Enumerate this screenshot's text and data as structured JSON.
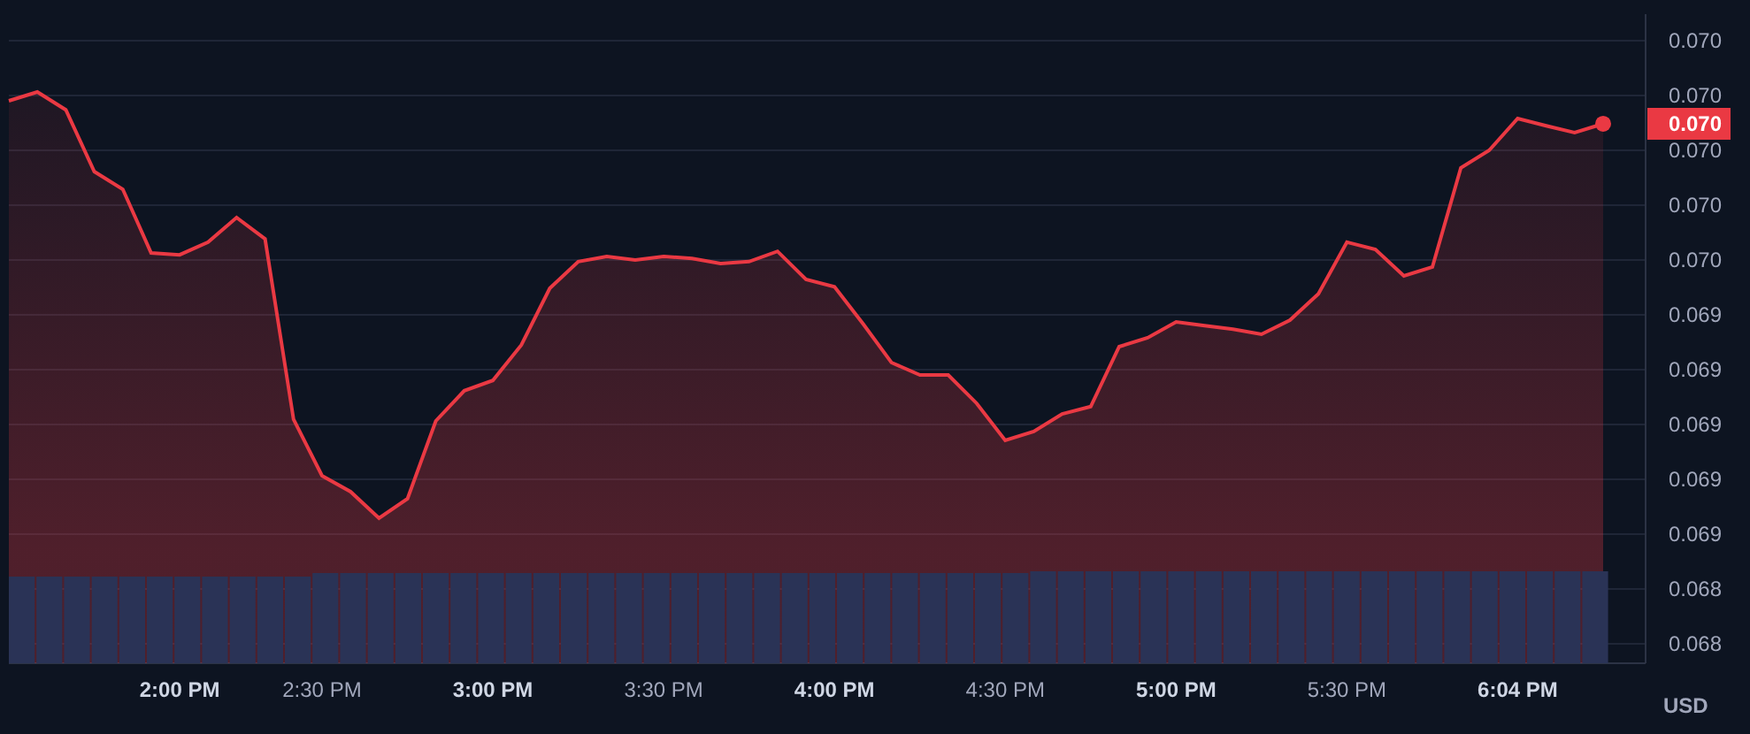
{
  "chart_data": {
    "type": "area",
    "grid": true,
    "categories": [
      null,
      null,
      null,
      null,
      null,
      null,
      "2:00 PM",
      null,
      null,
      null,
      null,
      "2:30 PM",
      null,
      null,
      null,
      null,
      null,
      "3:00 PM",
      null,
      null,
      null,
      null,
      null,
      "3:30 PM",
      null,
      null,
      null,
      null,
      null,
      "4:00 PM",
      null,
      null,
      null,
      null,
      null,
      "4:30 PM",
      null,
      null,
      null,
      null,
      null,
      "5:00 PM",
      null,
      null,
      null,
      null,
      null,
      "5:30 PM",
      null,
      null,
      null,
      null,
      null,
      "6:04 PM",
      null,
      null,
      null
    ],
    "series": [
      {
        "color": "#ea3943",
        "values": [
          0.070081,
          0.070113,
          0.070048,
          0.069823,
          0.069758,
          0.069526,
          0.069519,
          0.069565,
          0.069655,
          0.069577,
          0.068919,
          0.068713,
          0.068655,
          0.068558,
          0.068629,
          0.068913,
          0.069023,
          0.069061,
          0.06919,
          0.069397,
          0.069494,
          0.069513,
          0.0695,
          0.069513,
          0.069506,
          0.069487,
          0.069494,
          0.069532,
          0.069429,
          0.069403,
          0.069268,
          0.069126,
          0.069081,
          0.069081,
          0.068977,
          0.068842,
          0.068874,
          0.068939,
          0.068965,
          0.069184,
          0.069216,
          0.069274,
          0.069261,
          0.069248,
          0.069229,
          0.069281,
          0.069377,
          0.069565,
          0.069539,
          0.069442,
          0.069474,
          0.069836,
          0.0699,
          0.070016,
          0.06999,
          0.069965,
          0.069997
        ]
      }
    ],
    "ylim": [
      0.068029,
      0.070397
    ],
    "yticks": [
      {
        "value": 0.0703,
        "label": "0.070"
      },
      {
        "value": 0.0701,
        "label": "0.070"
      },
      {
        "value": 0.0699,
        "label": "0.070"
      },
      {
        "value": 0.0697,
        "label": "0.070"
      },
      {
        "value": 0.0695,
        "label": "0.070"
      },
      {
        "value": 0.0693,
        "label": "0.069"
      },
      {
        "value": 0.0691,
        "label": "0.069"
      },
      {
        "value": 0.0689,
        "label": "0.069"
      },
      {
        "value": 0.0687,
        "label": "0.069"
      },
      {
        "value": 0.0685,
        "label": "0.069"
      },
      {
        "value": 0.0683,
        "label": "0.068"
      },
      {
        "value": 0.0681,
        "label": "0.068"
      }
    ],
    "annotations": [
      {
        "text": "0.070"
      }
    ]
  },
  "x_labels_bold": [
    true,
    false,
    true,
    false,
    true,
    false,
    true,
    false,
    true
  ],
  "currency": "USD"
}
